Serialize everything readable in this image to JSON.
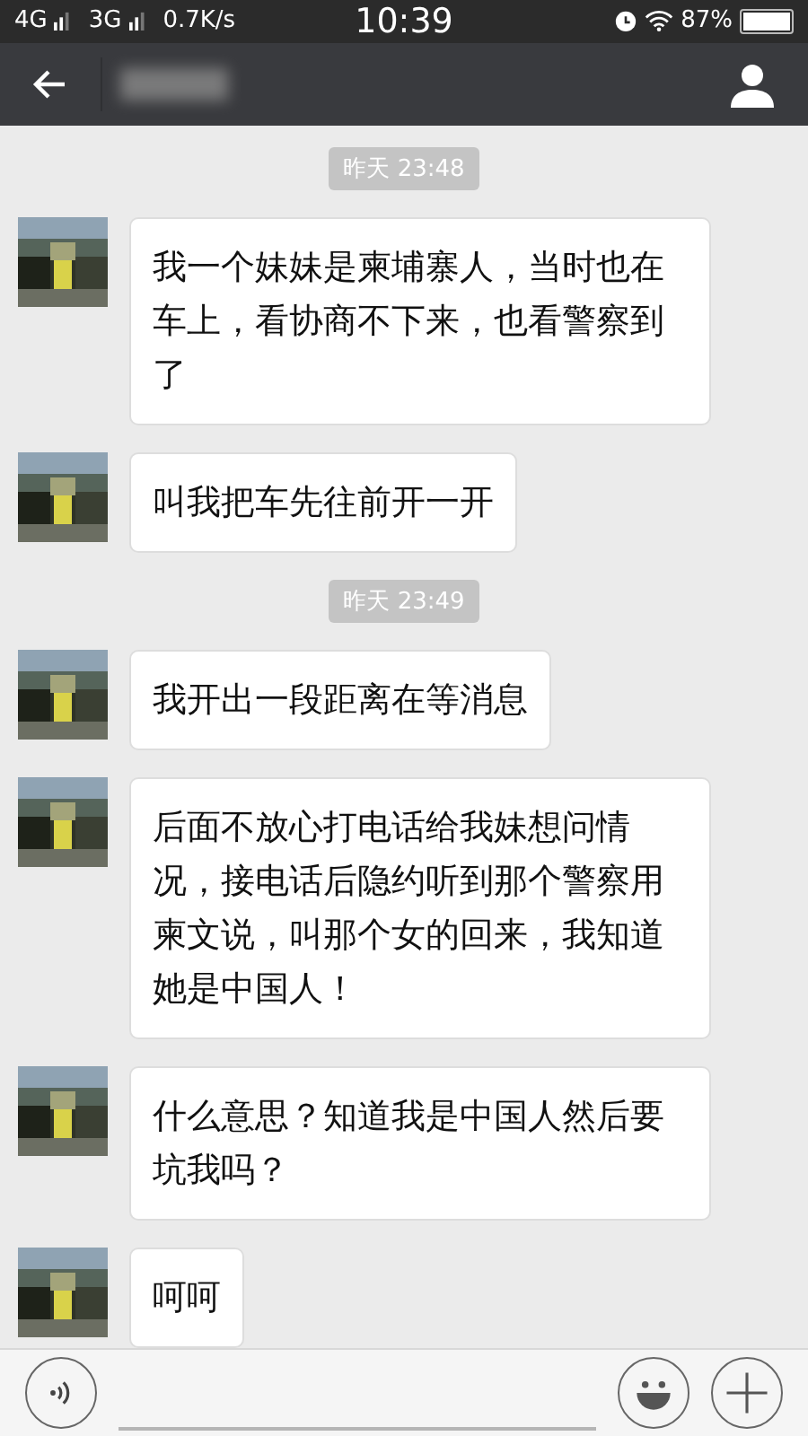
{
  "status_bar": {
    "network_1": "4G",
    "network_2": "3G",
    "speed": "0.7K/s",
    "time": "10:39",
    "battery": "87%"
  },
  "messages": [
    {
      "kind": "time",
      "text": "昨天 23:48"
    },
    {
      "kind": "text",
      "text": "我一个妹妹是柬埔寨人，当时也在车上，看协商不下来，也看警察到了"
    },
    {
      "kind": "text",
      "text": "叫我把车先往前开一开"
    },
    {
      "kind": "time",
      "text": "昨天 23:49"
    },
    {
      "kind": "text",
      "text": "我开出一段距离在等消息"
    },
    {
      "kind": "text",
      "text": "后面不放心打电话给我妹想问情况，接电话后隐约听到那个警察用柬文说，叫那个女的回来，我知道她是中国人！"
    },
    {
      "kind": "text",
      "text": "什么意思？知道我是中国人然后要坑我吗？"
    },
    {
      "kind": "text",
      "text": "呵呵"
    }
  ]
}
